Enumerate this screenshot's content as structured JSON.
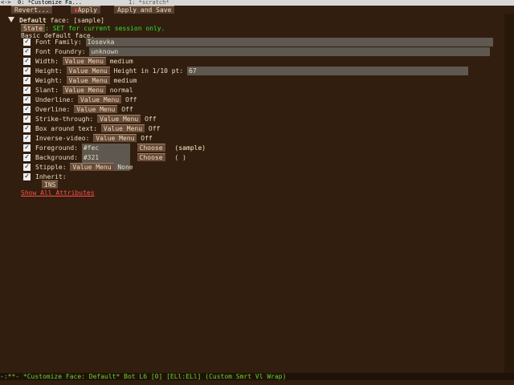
{
  "tabs": [
    {
      "label": "<->"
    },
    {
      "label": "0: *Customize Fa..."
    },
    {
      "label": "1: *scratch*"
    }
  ],
  "toolbar": {
    "revert": "Revert...",
    "apply": "Apply",
    "apply_save": "Apply and Save"
  },
  "face_header": {
    "title": "Default",
    "face_word": " face: ",
    "sample": "[sample]"
  },
  "state": {
    "button": "State",
    "text": ": SET for current session only."
  },
  "doc": "Basic default face.",
  "attributes": [
    {
      "label": "Font Family:",
      "value": "Iosevka",
      "kind": "field"
    },
    {
      "label": "Font Foundry:",
      "value": "unknown",
      "kind": "field"
    },
    {
      "label": "Width:",
      "menu": "Value Menu",
      "value": "medium",
      "kind": "menu"
    },
    {
      "label": "Height:",
      "menu": "Value Menu",
      "extra": "Height in 1/10 pt:",
      "value": "67",
      "kind": "height"
    },
    {
      "label": "Weight:",
      "menu": "Value Menu",
      "value": "medium",
      "kind": "menu"
    },
    {
      "label": "Slant:",
      "menu": "Value Menu",
      "value": "normal",
      "kind": "menu"
    },
    {
      "label": "Underline:",
      "menu": "Value Menu",
      "value": "Off",
      "kind": "menu"
    },
    {
      "label": "Overline:",
      "menu": "Value Menu",
      "value": "Off",
      "kind": "menu"
    },
    {
      "label": "Strike-through:",
      "menu": "Value Menu",
      "value": "Off",
      "kind": "menu"
    },
    {
      "label": "Box around text:",
      "menu": "Value Menu",
      "value": "Off",
      "kind": "menu"
    },
    {
      "label": "Inverse-video:",
      "menu": "Value Menu",
      "value": "Off",
      "kind": "menu"
    },
    {
      "label": "Foreground:",
      "value": "#fec",
      "choose": "Choose",
      "sample": "(sample)",
      "kind": "color"
    },
    {
      "label": "Background:",
      "value": "#321",
      "choose": "Choose",
      "sample": "(      )",
      "kind": "color"
    },
    {
      "label": "Stipple:",
      "menu": "Value Menu",
      "value": "None",
      "kind": "menu"
    },
    {
      "label": "Inherit:",
      "kind": "inherit"
    }
  ],
  "ins_button": "INS",
  "show_all": "Show All Attributes",
  "modeline": "-:**-  *Customize Face: Default*   Bot L6    [0]   [ELl:ELl] (Custom Smrt Vl Wrap)",
  "colors": {
    "background": "#321e0e",
    "foreground": "#ffeecc",
    "accent_green": "#30e030",
    "link_red": "#ff5050"
  }
}
